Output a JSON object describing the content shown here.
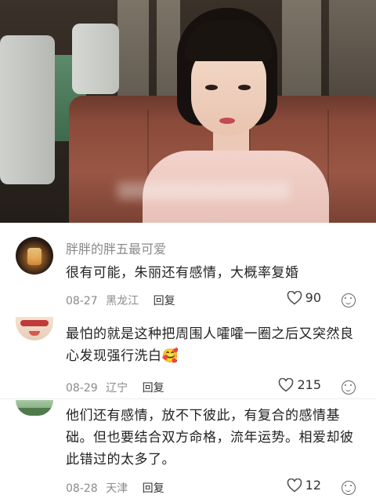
{
  "comments": [
    {
      "username": "胖胖的胖五最可爱",
      "text": "很有可能，朱丽还有感情，大概率复婚",
      "date": "08-27",
      "location": "黑龙江",
      "reply_label": "回复",
      "likes": "90"
    },
    {
      "username": "",
      "text": "最怕的就是这种把周围人嚯嚯一圈之后又突然良心发现强行洗白🥰",
      "date": "08-29",
      "location": "辽宁",
      "reply_label": "回复",
      "likes": "215"
    },
    {
      "username": "",
      "text": "他们还有感情，放不下彼此，有复合的感情基础。但也要结合双方命格，流年运势。相爱却彼此错过的太多了。",
      "date": "08-28",
      "location": "天津",
      "reply_label": "回复",
      "likes": "12"
    }
  ],
  "icons": {
    "like": "heart-outline-icon",
    "more": "smiley-icon"
  },
  "colors": {
    "meta_gray": "#8a8a8a",
    "text_dark": "#222222"
  }
}
